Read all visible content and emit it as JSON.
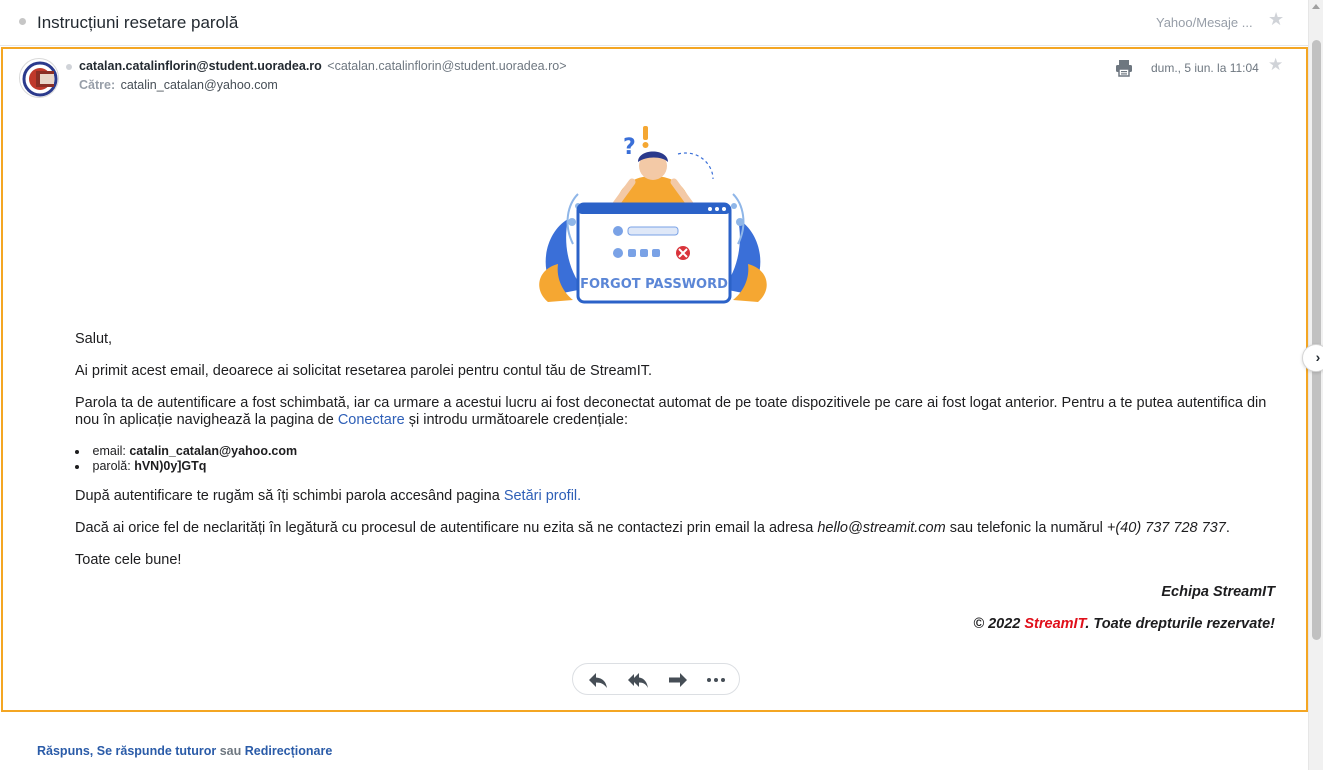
{
  "header": {
    "subject": "Instrucțiuni resetare parolă",
    "folder": "Yahoo/Mesaje ...",
    "star_icon": "star-icon"
  },
  "message": {
    "sender_name": "catalan.catalinflorin@student.uoradea.ro",
    "sender_address": "<catalan.catalinflorin@student.uoradea.ro>",
    "to_label": "Către:",
    "to_address": "catalin_catalan@yahoo.com",
    "date": "dum., 5 iun. la 11:04",
    "illustration_caption": "FORGOT PASSWORD"
  },
  "body": {
    "greeting": "Salut,",
    "intro": "Ai primit acest email, deoarece ai solicitat resetarea parolei pentru contul tău de StreamIT.",
    "para2_before": "Parola ta de autentificare a fost schimbată, iar ca urmare a acestui lucru ai fost deconectat automat de pe toate dispozitivele pe care ai fost logat anterior. Pentru a te putea autentifica din nou în aplicație navighează la pagina de ",
    "para2_link": "Conectare",
    "para2_after": " și introdu următoarele credențiale:",
    "cred_email_label": "email: ",
    "cred_email_value": "catalin_catalan@yahoo.com",
    "cred_pass_label": "parolă: ",
    "cred_pass_value": "hVN)0y]GTq",
    "para3_before": "După autentificare te rugăm să îți schimbi parola accesând pagina ",
    "para3_link": "Setări profil.",
    "para4_before": "Dacă ai orice fel de neclarități în legătură cu procesul de autentificare nu ezita să ne contactezi prin email la adresa ",
    "para4_email": "hello@streamit.com",
    "para4_mid": " sau telefonic la numărul ",
    "para4_phone": "+(40) 737 728 737",
    "para4_end": ".",
    "closing": "Toate cele bune!",
    "signature": "Echipa StreamIT",
    "copyright_before": "© 2022 ",
    "copyright_brand": "StreamIT",
    "copyright_after": ". Toate drepturile rezervate!"
  },
  "footer": {
    "reply": "Răspuns",
    "comma": ",",
    "reply_all": "Se răspunde tuturor",
    "or": "sau",
    "forward": "Redirecționare"
  },
  "colors": {
    "focus_border": "#f4a623",
    "link": "#2e5fb7",
    "brand_red": "#e0101b",
    "footer_link": "#0f69ff"
  }
}
